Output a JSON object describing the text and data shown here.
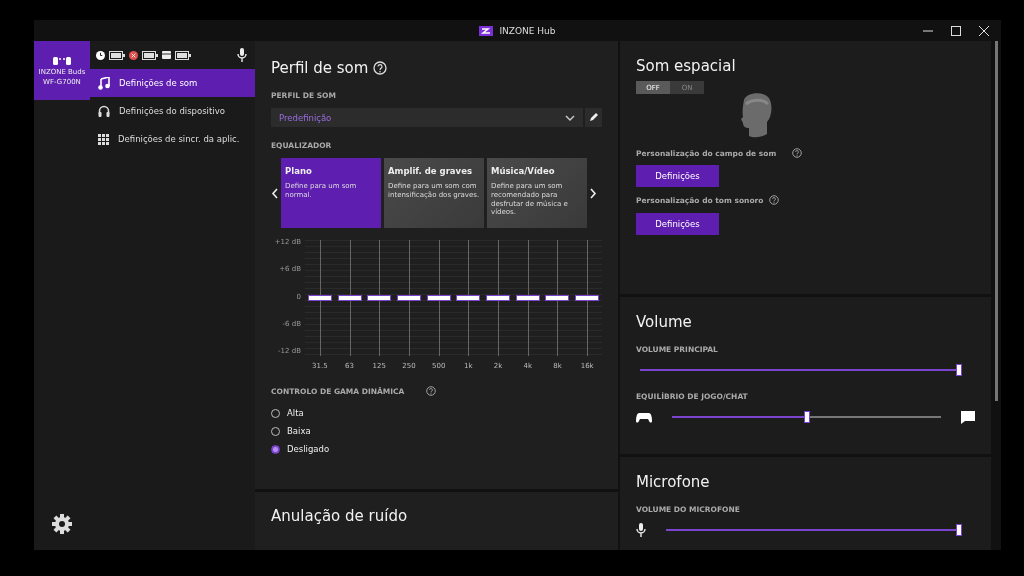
{
  "window": {
    "title": "INZONE Hub"
  },
  "device": {
    "name": "INZONE Buds",
    "model": "WF-G700N"
  },
  "sidebar": {
    "items": [
      {
        "label": "Definições de som",
        "selected": true
      },
      {
        "label": "Definições do dispositivo",
        "selected": false
      },
      {
        "label": "Definições de sincr. da aplic.",
        "selected": false
      }
    ]
  },
  "sound_profile": {
    "title": "Perfil de som",
    "profile_label": "PERFIL DE SOM",
    "profile_value": "Predefinição",
    "eq_label": "EQUALIZADOR",
    "presets": [
      {
        "title": "Plano",
        "description": "Define para um som normal.",
        "selected": true
      },
      {
        "title": "Amplif. de graves",
        "description": "Define para um som com intensificação dos graves.",
        "selected": false
      },
      {
        "title": "Música/Vídeo",
        "description": "Define para um som recomendado para desfrutar de música e vídeos.",
        "selected": false
      }
    ],
    "eq_scale": [
      "+12 dB",
      "+6 dB",
      "0",
      "-6 dB",
      "-12 dB"
    ],
    "bands": [
      {
        "label": "31.5",
        "level": 0.5
      },
      {
        "label": "63",
        "level": 0.5
      },
      {
        "label": "125",
        "level": 0.5
      },
      {
        "label": "250",
        "level": 0.5
      },
      {
        "label": "500",
        "level": 0.5
      },
      {
        "label": "1k",
        "level": 0.5
      },
      {
        "label": "2k",
        "level": 0.5
      },
      {
        "label": "4k",
        "level": 0.5
      },
      {
        "label": "8k",
        "level": 0.5
      },
      {
        "label": "16k",
        "level": 0.5
      }
    ],
    "dynamic_label": "CONTROLO DE GAMA DINÂMICA",
    "dynamic_options": [
      {
        "label": "Alta",
        "selected": false
      },
      {
        "label": "Baixa",
        "selected": false
      },
      {
        "label": "Desligado",
        "selected": true
      }
    ]
  },
  "noise_cancel": {
    "title": "Anulação de ruído"
  },
  "spatial": {
    "title": "Som espacial",
    "toggle_off": "OFF",
    "toggle_on": "ON",
    "on": false,
    "field_label": "Personalização do campo de som",
    "field_button": "Definições",
    "tone_label": "Personalização do tom sonoro",
    "tone_button": "Definições"
  },
  "volume": {
    "title": "Volume",
    "main_label": "VOLUME PRINCIPAL",
    "main": {
      "level": 1.0
    },
    "balance_label": "EQUILÍBRIO DE JOGO/CHAT",
    "balance": {
      "level": 0.5
    }
  },
  "microphone": {
    "title": "Microfone",
    "volume_label": "VOLUME DO MICROFONE",
    "volume": {
      "level": 1.0
    }
  }
}
